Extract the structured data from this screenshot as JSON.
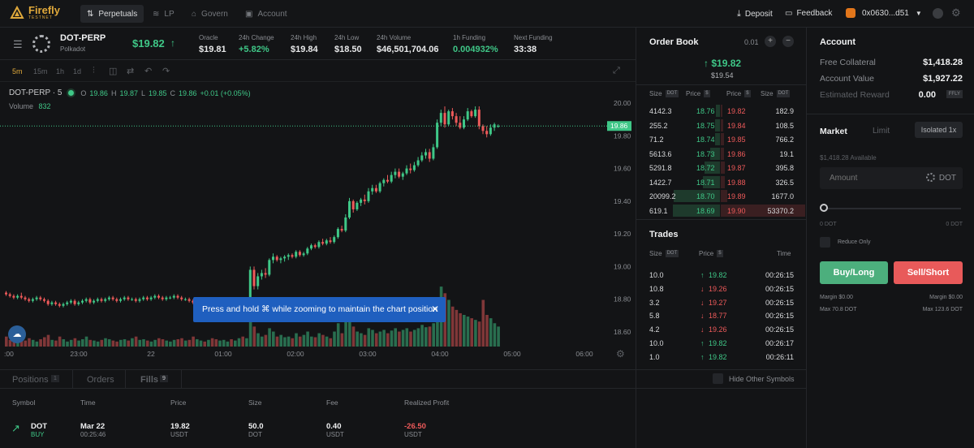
{
  "app": {
    "name": "Firefly",
    "subtitle": "TESTNET"
  },
  "nav": [
    {
      "label": "Perpetuals",
      "icon": "chart-icon"
    },
    {
      "label": "LP",
      "icon": "layers-icon"
    },
    {
      "label": "Govern",
      "icon": "bank-icon"
    },
    {
      "label": "Account",
      "icon": "wallet-icon"
    }
  ],
  "header": {
    "deposit": "Deposit",
    "feedback": "Feedback",
    "wallet": "0x0630...d51"
  },
  "market": {
    "symbol": "DOT-PERP",
    "name": "Polkadot",
    "price": "$19.82",
    "stats": [
      {
        "label": "Oracle",
        "value": "$19.81"
      },
      {
        "label": "24h Change",
        "value": "+5.82%"
      },
      {
        "label": "24h High",
        "value": "$19.84"
      },
      {
        "label": "24h Low",
        "value": "$18.50"
      },
      {
        "label": "24h Volume",
        "value": "$46,501,704.06"
      },
      {
        "label": "1h Funding",
        "value": "0.004932%"
      },
      {
        "label": "Next Funding",
        "value": "33:38"
      }
    ]
  },
  "chart_toolbar": {
    "intervals": [
      "5m",
      "15m",
      "1h",
      "1d"
    ]
  },
  "chart_legend": {
    "title": "DOT-PERP · 5",
    "o_label": "O",
    "o": "19.86",
    "h_label": "H",
    "h": "19.87",
    "l_label": "L",
    "l": "19.85",
    "c_label": "C",
    "c": "19.86",
    "change": "+0.01 (+0.05%)",
    "volume_label": "Volume",
    "volume": "832"
  },
  "chart_axis": {
    "y_ticks": [
      "20.00",
      "19.80",
      "19.60",
      "19.40",
      "19.20",
      "19.00",
      "18.80",
      "18.60"
    ],
    "x_ticks": [
      ":00",
      "23:00",
      "22",
      "01:00",
      "02:00",
      "03:00",
      "04:00",
      "05:00",
      "06:00"
    ],
    "current_price": "19.86"
  },
  "chart_data": {
    "type": "candlestick",
    "candles": [
      [
        18.84,
        18.85,
        18.82,
        18.83
      ],
      [
        18.83,
        18.84,
        18.81,
        18.82
      ],
      [
        18.82,
        18.83,
        18.8,
        18.81
      ],
      [
        18.81,
        18.83,
        18.8,
        18.82
      ],
      [
        18.82,
        18.84,
        18.8,
        18.81
      ],
      [
        18.81,
        18.82,
        18.79,
        18.8
      ],
      [
        18.8,
        18.81,
        18.78,
        18.79
      ],
      [
        18.79,
        18.81,
        18.78,
        18.8
      ],
      [
        18.8,
        18.82,
        18.79,
        18.81
      ],
      [
        18.81,
        18.82,
        18.79,
        18.8
      ],
      [
        18.8,
        18.81,
        18.78,
        18.79
      ],
      [
        18.79,
        18.8,
        18.76,
        18.77
      ],
      [
        18.77,
        18.79,
        18.76,
        18.78
      ],
      [
        18.78,
        18.79,
        18.76,
        18.77
      ],
      [
        18.77,
        18.78,
        18.75,
        18.76
      ],
      [
        18.76,
        18.78,
        18.75,
        18.77
      ],
      [
        18.77,
        18.79,
        18.76,
        18.78
      ],
      [
        18.78,
        18.8,
        18.77,
        18.79
      ],
      [
        18.79,
        18.8,
        18.76,
        18.77
      ],
      [
        18.77,
        18.79,
        18.76,
        18.78
      ],
      [
        18.78,
        18.8,
        18.77,
        18.79
      ],
      [
        18.79,
        18.81,
        18.78,
        18.8
      ],
      [
        18.8,
        18.81,
        18.77,
        18.78
      ],
      [
        18.78,
        18.8,
        18.77,
        18.79
      ],
      [
        18.79,
        18.81,
        18.78,
        18.8
      ],
      [
        18.8,
        18.81,
        18.78,
        18.79
      ],
      [
        18.79,
        18.81,
        18.78,
        18.8
      ],
      [
        18.8,
        18.82,
        18.79,
        18.81
      ],
      [
        18.81,
        18.82,
        18.79,
        18.8
      ],
      [
        18.8,
        18.81,
        18.78,
        18.79
      ],
      [
        18.79,
        18.81,
        18.78,
        18.8
      ],
      [
        18.8,
        18.82,
        18.79,
        18.81
      ],
      [
        18.81,
        18.82,
        18.79,
        18.8
      ],
      [
        18.8,
        18.81,
        18.79,
        18.8
      ],
      [
        18.8,
        18.81,
        18.78,
        18.79
      ],
      [
        18.79,
        18.81,
        18.78,
        18.8
      ],
      [
        18.8,
        18.82,
        18.79,
        18.81
      ],
      [
        18.81,
        18.82,
        18.79,
        18.8
      ],
      [
        18.8,
        18.82,
        18.79,
        18.81
      ],
      [
        18.81,
        18.83,
        18.8,
        18.82
      ],
      [
        18.82,
        18.83,
        18.8,
        18.81
      ],
      [
        18.81,
        18.82,
        18.79,
        18.8
      ],
      [
        18.8,
        18.82,
        18.79,
        18.81
      ],
      [
        18.81,
        18.82,
        18.8,
        18.81
      ],
      [
        18.81,
        18.83,
        18.8,
        18.82
      ],
      [
        18.82,
        18.83,
        18.8,
        18.81
      ],
      [
        18.81,
        18.82,
        18.79,
        18.8
      ],
      [
        18.8,
        18.81,
        18.79,
        18.8
      ],
      [
        18.8,
        18.81,
        18.78,
        18.79
      ],
      [
        18.79,
        18.8,
        18.77,
        18.78
      ],
      [
        18.78,
        18.8,
        18.77,
        18.79
      ],
      [
        18.79,
        18.81,
        18.78,
        18.8
      ],
      [
        18.8,
        18.81,
        18.78,
        18.79
      ],
      [
        18.79,
        18.81,
        18.78,
        18.8
      ],
      [
        18.8,
        18.81,
        18.78,
        18.79
      ],
      [
        18.79,
        18.8,
        18.77,
        18.78
      ],
      [
        18.78,
        18.8,
        18.77,
        18.79
      ],
      [
        18.79,
        18.81,
        18.78,
        18.8
      ],
      [
        18.8,
        18.81,
        18.79,
        18.8
      ],
      [
        18.8,
        18.81,
        18.78,
        18.79
      ],
      [
        18.79,
        18.81,
        18.78,
        18.8
      ],
      [
        18.8,
        18.81,
        18.79,
        18.8
      ],
      [
        18.8,
        18.8,
        18.78,
        18.79
      ],
      [
        18.79,
        18.8,
        18.78,
        18.79
      ],
      [
        18.79,
        19.0,
        18.78,
        18.98
      ],
      [
        18.98,
        19.0,
        18.86,
        18.88
      ],
      [
        18.88,
        18.96,
        18.86,
        18.94
      ],
      [
        18.94,
        18.98,
        18.92,
        18.96
      ],
      [
        18.96,
        18.99,
        18.93,
        18.95
      ],
      [
        18.95,
        19.05,
        18.94,
        19.04
      ],
      [
        19.04,
        19.08,
        19.02,
        19.06
      ],
      [
        19.06,
        19.07,
        19.03,
        19.04
      ],
      [
        19.04,
        19.06,
        19.02,
        19.05
      ],
      [
        19.05,
        19.07,
        19.03,
        19.06
      ],
      [
        19.06,
        19.08,
        19.04,
        19.07
      ],
      [
        19.07,
        19.08,
        19.05,
        19.06
      ],
      [
        19.06,
        19.1,
        19.05,
        19.09
      ],
      [
        19.09,
        19.1,
        19.06,
        19.07
      ],
      [
        19.07,
        19.09,
        19.06,
        19.08
      ],
      [
        19.08,
        19.12,
        19.07,
        19.11
      ],
      [
        19.11,
        19.14,
        19.1,
        19.13
      ],
      [
        19.13,
        19.14,
        19.11,
        19.12
      ],
      [
        19.12,
        19.16,
        19.11,
        19.15
      ],
      [
        19.15,
        19.17,
        19.13,
        19.14
      ],
      [
        19.14,
        19.17,
        19.13,
        19.16
      ],
      [
        19.16,
        19.18,
        19.14,
        19.15
      ],
      [
        19.15,
        19.19,
        19.14,
        19.18
      ],
      [
        19.18,
        19.24,
        19.17,
        19.23
      ],
      [
        19.23,
        19.25,
        19.21,
        19.22
      ],
      [
        19.22,
        19.32,
        19.21,
        19.3
      ],
      [
        19.3,
        19.42,
        19.29,
        19.4
      ],
      [
        19.4,
        19.41,
        19.33,
        19.35
      ],
      [
        19.35,
        19.4,
        19.34,
        19.39
      ],
      [
        19.39,
        19.42,
        19.37,
        19.41
      ],
      [
        19.41,
        19.44,
        19.38,
        19.4
      ],
      [
        19.4,
        19.48,
        19.39,
        19.46
      ],
      [
        19.46,
        19.5,
        19.44,
        19.48
      ],
      [
        19.48,
        19.5,
        19.45,
        19.46
      ],
      [
        19.46,
        19.52,
        19.45,
        19.51
      ],
      [
        19.51,
        19.54,
        19.49,
        19.53
      ],
      [
        19.53,
        19.56,
        19.51,
        19.52
      ],
      [
        19.52,
        19.58,
        19.51,
        19.56
      ],
      [
        19.56,
        19.6,
        19.54,
        19.58
      ],
      [
        19.58,
        19.6,
        19.54,
        19.55
      ],
      [
        19.55,
        19.58,
        19.53,
        19.57
      ],
      [
        19.57,
        19.62,
        19.56,
        19.6
      ],
      [
        19.6,
        19.63,
        19.57,
        19.59
      ],
      [
        19.59,
        19.64,
        19.58,
        19.62
      ],
      [
        19.62,
        19.67,
        19.61,
        19.65
      ],
      [
        19.65,
        19.7,
        19.64,
        19.68
      ],
      [
        19.68,
        19.72,
        19.66,
        19.7
      ],
      [
        19.7,
        19.72,
        19.64,
        19.66
      ],
      [
        19.66,
        19.75,
        19.65,
        19.73
      ],
      [
        19.73,
        19.9,
        19.72,
        19.88
      ],
      [
        19.88,
        19.96,
        19.86,
        19.94
      ],
      [
        19.94,
        19.98,
        19.85,
        19.87
      ],
      [
        19.87,
        19.96,
        19.86,
        19.95
      ],
      [
        19.95,
        19.97,
        19.9,
        19.92
      ],
      [
        19.92,
        19.94,
        19.86,
        19.88
      ],
      [
        19.88,
        19.92,
        19.84,
        19.85
      ],
      [
        19.85,
        19.92,
        19.84,
        19.9
      ],
      [
        19.9,
        19.97,
        19.89,
        19.95
      ],
      [
        19.95,
        19.96,
        19.91,
        19.92
      ],
      [
        19.92,
        19.98,
        19.91,
        19.96
      ],
      [
        19.96,
        19.98,
        19.84,
        19.86
      ],
      [
        19.86,
        19.87,
        19.81,
        19.83
      ],
      [
        19.83,
        19.86,
        19.79,
        19.81
      ],
      [
        19.81,
        19.87,
        19.8,
        19.85
      ],
      [
        19.85,
        19.88,
        19.83,
        19.87
      ],
      [
        19.86,
        19.87,
        19.85,
        19.86
      ]
    ],
    "volumes": [
      30,
      20,
      25,
      15,
      20,
      18,
      25,
      20,
      15,
      22,
      28,
      35,
      20,
      18,
      30,
      22,
      15,
      20,
      25,
      18,
      22,
      30,
      20,
      18,
      15,
      20,
      25,
      22,
      18,
      15,
      20,
      22,
      18,
      25,
      30,
      20,
      22,
      18,
      15,
      20,
      25,
      22,
      18,
      15,
      20,
      22,
      25,
      18,
      20,
      30,
      22,
      18,
      15,
      20,
      25,
      22,
      18,
      20,
      15,
      22,
      18,
      25,
      30,
      25,
      120,
      60,
      40,
      30,
      35,
      55,
      45,
      30,
      35,
      28,
      30,
      25,
      40,
      30,
      35,
      45,
      30,
      28,
      40,
      35,
      30,
      25,
      45,
      70,
      40,
      90,
      110,
      60,
      45,
      40,
      35,
      55,
      50,
      40,
      45,
      50,
      40,
      48,
      55,
      45,
      50,
      55,
      45,
      50,
      55,
      65,
      58,
      60,
      70,
      95,
      180,
      160,
      140,
      120,
      110,
      100,
      95,
      90,
      85,
      80,
      75,
      140,
      95,
      85,
      70,
      60,
      20
    ]
  },
  "toast": {
    "text": "Press and hold ⌘ while zooming to maintain the chart position"
  },
  "orderbook": {
    "title": "Order Book",
    "tick": "0.01",
    "last_price": "19.82",
    "mark_price": "$19.54",
    "headers": {
      "size": "Size",
      "dot": "DOT",
      "price": "Price",
      "usd": "$"
    },
    "rows": [
      {
        "bid_size": "4142.3",
        "bid_price": "18.76",
        "ask_price": "19.82",
        "ask_size": "182.9",
        "bid_depth": 0.05,
        "ask_depth": 0.02
      },
      {
        "bid_size": "255.2",
        "bid_price": "18.75",
        "ask_price": "19.84",
        "ask_size": "108.5",
        "bid_depth": 0.06,
        "ask_depth": 0.03
      },
      {
        "bid_size": "71.2",
        "bid_price": "18.74",
        "ask_price": "19.85",
        "ask_size": "766.2",
        "bid_depth": 0.06,
        "ask_depth": 0.04
      },
      {
        "bid_size": "5613.6",
        "bid_price": "18.73",
        "ask_price": "19.86",
        "ask_size": "19.1",
        "bid_depth": 0.12,
        "ask_depth": 0.04
      },
      {
        "bid_size": "5291.8",
        "bid_price": "18.72",
        "ask_price": "19.87",
        "ask_size": "395.8",
        "bid_depth": 0.18,
        "ask_depth": 0.05
      },
      {
        "bid_size": "1422.7",
        "bid_price": "18.71",
        "ask_price": "19.88",
        "ask_size": "326.5",
        "bid_depth": 0.2,
        "ask_depth": 0.05
      },
      {
        "bid_size": "20099.2",
        "bid_price": "18.70",
        "ask_price": "19.89",
        "ask_size": "1677.0",
        "bid_depth": 0.55,
        "ask_depth": 0.08
      },
      {
        "bid_size": "619.1",
        "bid_price": "18.69",
        "ask_price": "19.90",
        "ask_size": "53370.2",
        "bid_depth": 0.56,
        "ask_depth": 1.0
      }
    ]
  },
  "trades": {
    "title": "Trades",
    "headers": {
      "size": "Size",
      "dot": "DOT",
      "price": "Price",
      "usd": "$",
      "time": "Time"
    },
    "rows": [
      {
        "size": "10.0",
        "price": "19.82",
        "dir": "up",
        "time": "00:26:15"
      },
      {
        "size": "10.8",
        "price": "19.26",
        "dir": "down",
        "time": "00:26:15"
      },
      {
        "size": "3.2",
        "price": "19.27",
        "dir": "down",
        "time": "00:26:15"
      },
      {
        "size": "5.8",
        "price": "18.77",
        "dir": "down",
        "time": "00:26:15"
      },
      {
        "size": "4.2",
        "price": "19.26",
        "dir": "down",
        "time": "00:26:15"
      },
      {
        "size": "10.0",
        "price": "19.82",
        "dir": "up",
        "time": "00:26:17"
      },
      {
        "size": "1.0",
        "price": "19.82",
        "dir": "up",
        "time": "00:26:11"
      }
    ]
  },
  "account": {
    "title": "Account",
    "free_collateral_label": "Free Collateral",
    "free_collateral": "$1,418.28",
    "account_value_label": "Account Value",
    "account_value": "$1,927.22",
    "est_reward_label": "Estimated Reward",
    "est_reward": "0.00",
    "reward_token": "FFLY",
    "order_types": [
      "Market",
      "Limit"
    ],
    "margin_mode": "Isolated 1x",
    "available": "$1,418.28 Available",
    "amount_placeholder": "Amount",
    "amount_unit": "DOT",
    "slider_min": "0 DOT",
    "slider_max": "0 DOT",
    "slider_level": 0,
    "reduce_only": "Reduce Only",
    "buy_label": "Buy/Long",
    "sell_label": "Sell/Short",
    "buy_margin": "Margin $0.00",
    "sell_margin": "Margin $0.00",
    "buy_max": "Max 70.8 DOT",
    "sell_max": "Max 123.6 DOT"
  },
  "bottom": {
    "tabs": [
      {
        "label": "Positions",
        "count": "1"
      },
      {
        "label": "Orders",
        "count": ""
      },
      {
        "label": "Fills",
        "count": "9"
      }
    ],
    "hide_other": "Hide Other Symbols",
    "columns": [
      "Symbol",
      "Time",
      "Price",
      "Size",
      "Fee",
      "Realized Profit"
    ],
    "row": {
      "symbol": "DOT",
      "side": "BUY",
      "date": "Mar 22",
      "time": "00:25:46",
      "price": "19.82",
      "price_unit": "USDT",
      "size": "50.0",
      "size_unit": "DOT",
      "fee": "0.40",
      "fee_unit": "USDT",
      "profit": "-26.50",
      "profit_unit": "USDT"
    }
  },
  "colors": {
    "up": "#3fc787",
    "down": "#ee5a5a",
    "brand": "#e0a93b",
    "buy_btn": "#4caf7d",
    "sell_btn": "#e85a5a",
    "toast": "#1f5fbf"
  }
}
